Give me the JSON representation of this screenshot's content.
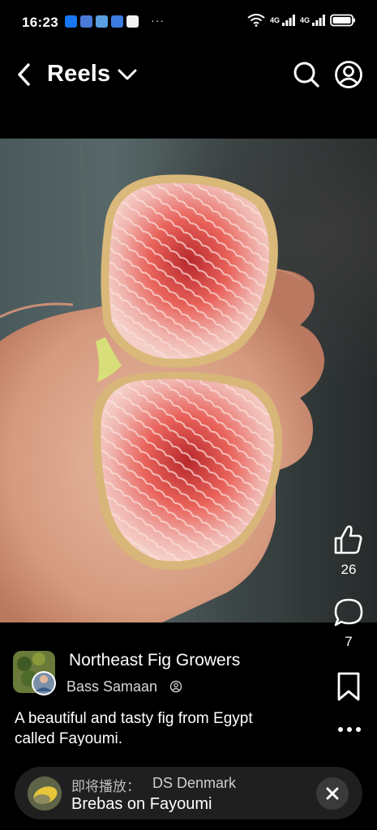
{
  "status_bar": {
    "time": "16:23",
    "notification_icons": [
      "facebook-icon",
      "app-icon",
      "app-icon",
      "app-icon",
      "music-icon"
    ],
    "more_notifications": "···",
    "wifi_label": "6",
    "signal1_label": "4G",
    "signal2_label": "4G"
  },
  "header": {
    "title": "Reels"
  },
  "actions": {
    "like_count": "26",
    "comment_count": "7"
  },
  "post": {
    "page_name": "Northeast Fig Growers",
    "author": "Bass Samaan",
    "caption": "A beautiful and tasty fig from Egypt called Fayoumi."
  },
  "up_next": {
    "prefix": "即将播放：",
    "channel": "DS Denmark",
    "title": "Brebas on Fayoumi"
  },
  "colors": {
    "background": "#000000",
    "up_next_bg": "#1f1f1f",
    "fig_flesh": "#e8625a"
  }
}
